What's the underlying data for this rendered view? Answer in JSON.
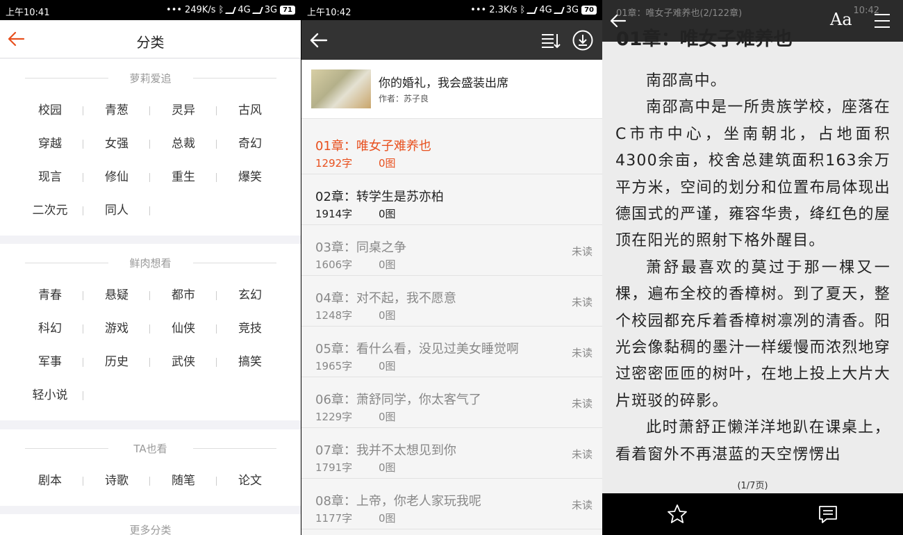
{
  "screen1": {
    "status": {
      "time": "上午10:41",
      "speed": "249K/s",
      "net1": "4G",
      "net2": "3G",
      "battery": "71"
    },
    "title": "分类",
    "sections": [
      {
        "title": "萝莉爱追",
        "items": [
          "校园",
          "青葱",
          "灵异",
          "古风",
          "穿越",
          "女强",
          "总裁",
          "奇幻",
          "现言",
          "修仙",
          "重生",
          "爆笑",
          "二次元",
          "同人"
        ]
      },
      {
        "title": "鲜肉想看",
        "items": [
          "青春",
          "悬疑",
          "都市",
          "玄幻",
          "科幻",
          "游戏",
          "仙侠",
          "竞技",
          "军事",
          "历史",
          "武侠",
          "搞笑",
          "轻小说"
        ]
      },
      {
        "title": "TA也看",
        "items": [
          "剧本",
          "诗歌",
          "随笔",
          "论文"
        ]
      },
      {
        "title": "更多分类"
      }
    ]
  },
  "screen2": {
    "status": {
      "time": "上午10:42",
      "speed": "2.3K/s",
      "net1": "4G",
      "net2": "3G",
      "battery": "70"
    },
    "book": {
      "title": "你的婚礼，我会盛装出席",
      "author": "作者：苏子良"
    },
    "chapters": [
      {
        "title": "01章：唯女子难养也",
        "words": "1292字",
        "images": "0图",
        "status": ""
      },
      {
        "title": "02章：转学生是苏亦柏",
        "words": "1914字",
        "images": "0图",
        "status": ""
      },
      {
        "title": "03章：同桌之争",
        "words": "1606字",
        "images": "0图",
        "status": "未读"
      },
      {
        "title": "04章：对不起，我不愿意",
        "words": "1248字",
        "images": "0图",
        "status": "未读"
      },
      {
        "title": "05章：看什么看，没见过美女睡觉啊",
        "words": "1965字",
        "images": "0图",
        "status": "未读"
      },
      {
        "title": "06章：萧舒同学，你太客气了",
        "words": "1229字",
        "images": "0图",
        "status": "未读"
      },
      {
        "title": "07章：我并不太想见到你",
        "words": "1791字",
        "images": "0图",
        "status": "未读"
      },
      {
        "title": "08章：上帝，你老人家玩我呢",
        "words": "1177字",
        "images": "0图",
        "status": "未读"
      }
    ]
  },
  "screen3": {
    "chapter_bar": "01章：唯女子难养也(2/122章)",
    "time": "10:42",
    "heading": "01章：唯女子难养也",
    "font_button": "Aa",
    "paragraphs": [
      "南邵高中。",
      "南邵高中是一所贵族学校，座落在C市市中心，坐南朝北，占地面积4300余亩，校舍总建筑面积163余万平方米，空间的划分和位置布局体现出德国式的严谨，雍容华贵，绛红色的屋顶在阳光的照射下格外醒目。",
      "萧舒最喜欢的莫过于那一棵又一棵，遍布全校的香樟树。到了夏天，整个校园都充斥着香樟树凛冽的清香。阳光会像黏稠的墨汁一样缓慢而浓烈地穿过密密匝匝的树叶，在地上投上大片大片斑驳的碎影。",
      "此时萧舒正懒洋洋地趴在课桌上，看着窗外不再湛蓝的天空愣愣出"
    ],
    "page": "(1/7页)"
  },
  "colors": {
    "accent": "#e8501e",
    "read": "#222222",
    "unread": "#888888"
  }
}
